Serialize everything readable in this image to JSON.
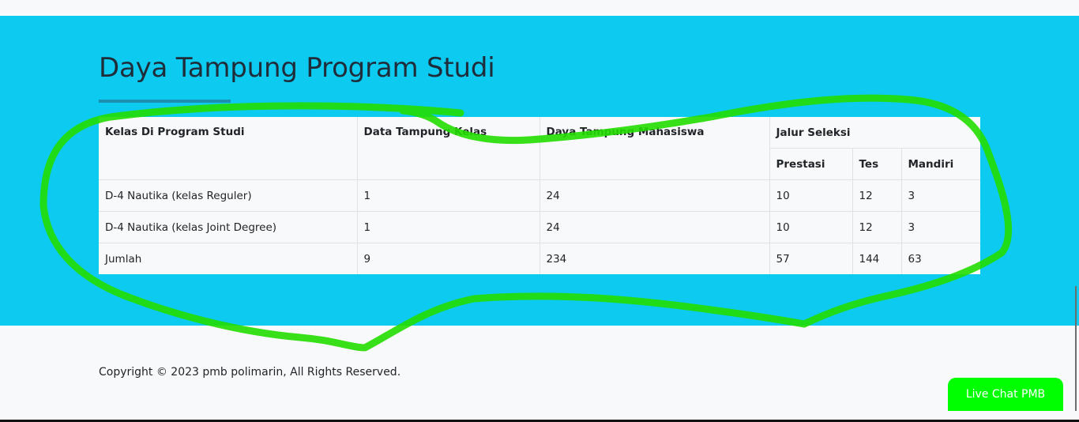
{
  "section": {
    "title": "Daya Tampung Program Studi"
  },
  "table": {
    "headers": {
      "kelas": "Kelas Di Program Studi",
      "data_tampung": "Data Tampung Kelas",
      "daya_tampung": "Daya Tampung Mahasiswa",
      "jalur": "Jalur Seleksi",
      "prestasi": "Prestasi",
      "tes": "Tes",
      "mandiri": "Mandiri"
    },
    "rows": [
      {
        "kelas": "D-4 Nautika (kelas Reguler)",
        "data_tampung": "1",
        "daya_tampung": "24",
        "prestasi": "10",
        "tes": "12",
        "mandiri": "3"
      },
      {
        "kelas": "D-4 Nautika (kelas Joint Degree)",
        "data_tampung": "1",
        "daya_tampung": "24",
        "prestasi": "10",
        "tes": "12",
        "mandiri": "3"
      },
      {
        "kelas": "Jumlah",
        "data_tampung": "9",
        "daya_tampung": "234",
        "prestasi": "57",
        "tes": "144",
        "mandiri": "63"
      }
    ]
  },
  "footer": {
    "copyright": "Copyright © 2023 pmb polimarin, All Rights Reserved."
  },
  "chat": {
    "label": "Live Chat PMB"
  },
  "colors": {
    "hero_background": "#0dcaf0",
    "page_background": "#f8f9fa",
    "chat_button": "#00ff00",
    "annotation_stroke": "#22dd00"
  }
}
